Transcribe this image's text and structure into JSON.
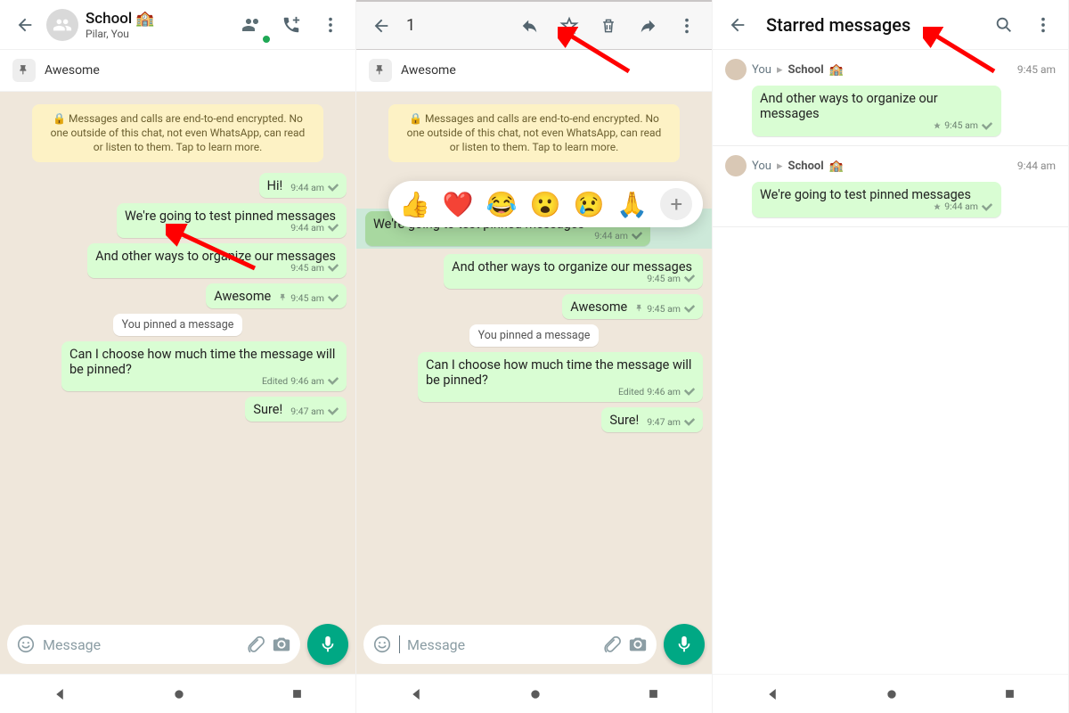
{
  "panel1": {
    "groupName": "School",
    "groupEmoji": "🏫",
    "subtitle": "Pilar, You",
    "pinnedText": "Awesome",
    "encryptText": "🔒 Messages and calls are end-to-end encrypted. No one outside of this chat, not even WhatsApp, can read or listen to them. Tap to learn more.",
    "msgs": [
      {
        "text": "Hi!",
        "time": "9:44 am"
      },
      {
        "text": "We're going to test pinned messages",
        "time": "9:44 am"
      },
      {
        "text": "And other ways to organize our messages",
        "time": "9:45 am"
      },
      {
        "text": "Awesome",
        "time": "9:45 am",
        "pinned": true
      },
      {
        "sys": "You pinned a message"
      },
      {
        "text": "Can I choose how much time the message will be pinned?",
        "time": "9:46 am",
        "edited": "Edited"
      },
      {
        "text": "Sure!",
        "time": "9:47 am"
      }
    ],
    "inputPlaceholder": "Message"
  },
  "panel2": {
    "selCount": "1",
    "pinnedText": "Awesome",
    "encryptText": "🔒 Messages and calls are end-to-end encrypted. No one outside of this chat, not even WhatsApp, can read or listen to them. Tap to learn more.",
    "reactions": [
      "👍",
      "❤️",
      "😂",
      "😮",
      "😢",
      "🙏"
    ],
    "inputPlaceholder": "Message"
  },
  "panel3": {
    "title": "Starred messages",
    "items": [
      {
        "sender": "You",
        "group": "School",
        "groupEmoji": "🏫",
        "time": "9:45 am",
        "text": "And other ways to organize our messages",
        "msgTime": "9:45 am"
      },
      {
        "sender": "You",
        "group": "School",
        "groupEmoji": "🏫",
        "time": "9:44 am",
        "text": "We're going to test pinned messages",
        "msgTime": "9:44 am"
      }
    ]
  }
}
